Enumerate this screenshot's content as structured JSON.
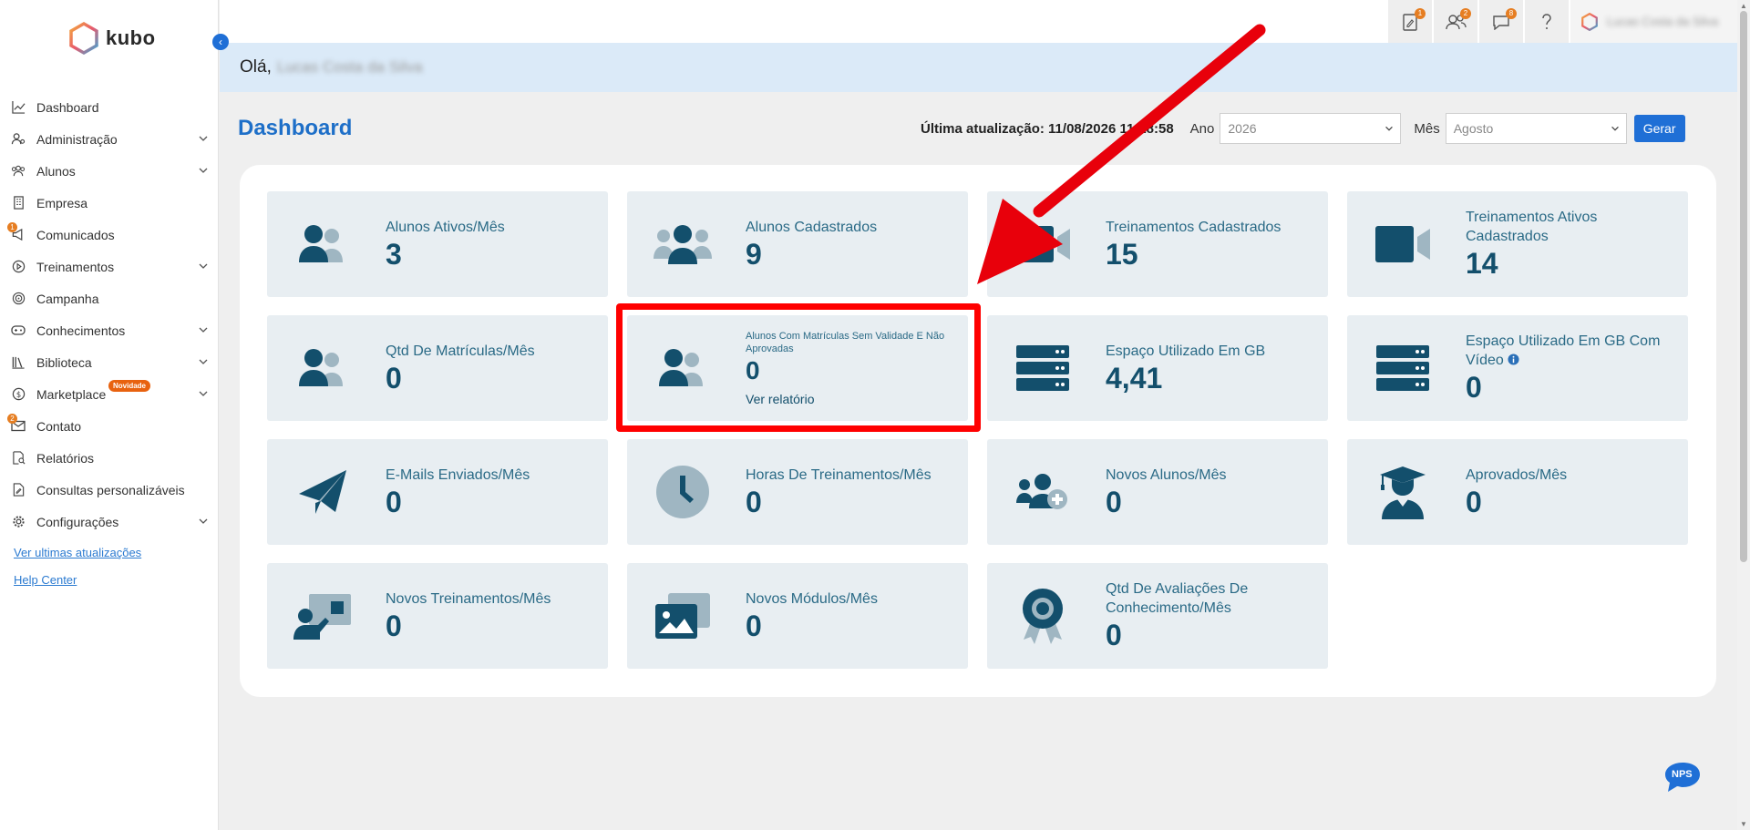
{
  "app": {
    "logo_text": "kubo"
  },
  "sidebar": {
    "items": [
      {
        "label": "Dashboard",
        "icon": "chart-line-icon",
        "chevron": false
      },
      {
        "label": "Administração",
        "icon": "users-gear-icon",
        "chevron": true
      },
      {
        "label": "Alunos",
        "icon": "students-icon",
        "chevron": true
      },
      {
        "label": "Empresa",
        "icon": "building-icon",
        "chevron": false
      },
      {
        "label": "Comunicados",
        "icon": "megaphone-icon",
        "chevron": false,
        "badge": "1"
      },
      {
        "label": "Treinamentos",
        "icon": "play-circle-icon",
        "chevron": true
      },
      {
        "label": "Campanha",
        "icon": "target-icon",
        "chevron": false
      },
      {
        "label": "Conhecimentos",
        "icon": "gamepad-icon",
        "chevron": true
      },
      {
        "label": "Biblioteca",
        "icon": "library-icon",
        "chevron": true
      },
      {
        "label": "Marketplace",
        "icon": "dollar-circle-icon",
        "chevron": true,
        "pill": "Novidade"
      },
      {
        "label": "Contato",
        "icon": "envelope-icon",
        "chevron": false,
        "badge": "2"
      },
      {
        "label": "Relatórios",
        "icon": "report-search-icon",
        "chevron": false
      },
      {
        "label": "Consultas personalizáveis",
        "icon": "document-edit-icon",
        "chevron": false
      },
      {
        "label": "Configurações",
        "icon": "gear-icon",
        "chevron": true
      }
    ],
    "links": {
      "updates": "Ver ultimas atualizações",
      "help": "Help Center"
    }
  },
  "topbar": {
    "badges": {
      "tasks": "1",
      "users": "2",
      "chat": "8"
    },
    "user_name": "Lucas Costa da Silva"
  },
  "greeting": {
    "prefix": "Olá,",
    "name": "Lucas Costa da Silva"
  },
  "header": {
    "title": "Dashboard",
    "last_update": "Última atualização: 11/08/2026 11:18:58",
    "year_label": "Ano",
    "year_value": "2026",
    "month_label": "Mês",
    "month_value": "Agosto",
    "generate_label": "Gerar"
  },
  "cards": [
    {
      "label": "Alunos Ativos/Mês",
      "value": "3",
      "icon": "users-icon"
    },
    {
      "label": "Alunos Cadastrados",
      "value": "9",
      "icon": "users-group-icon"
    },
    {
      "label": "Treinamentos Cadastrados",
      "value": "15",
      "icon": "video-camera-icon"
    },
    {
      "label": "Treinamentos Ativos Cadastrados",
      "value": "14",
      "icon": "video-camera-icon"
    },
    {
      "label": "Qtd De Matrículas/Mês",
      "value": "0",
      "icon": "users-icon"
    },
    {
      "label": "Alunos Com Matrículas Sem Validade E Não Aprovadas",
      "value": "0",
      "icon": "users-icon",
      "link": "Ver relatório"
    },
    {
      "label": "Espaço Utilizado Em GB",
      "value": "4,41",
      "icon": "server-icon"
    },
    {
      "label": "Espaço Utilizado Em GB Com Vídeo",
      "value": "0",
      "icon": "server-icon",
      "info": true
    },
    {
      "label": "E-Mails Enviados/Mês",
      "value": "0",
      "icon": "paper-plane-icon"
    },
    {
      "label": "Horas De Treinamentos/Mês",
      "value": "0",
      "icon": "clock-icon"
    },
    {
      "label": "Novos Alunos/Mês",
      "value": "0",
      "icon": "user-plus-icon"
    },
    {
      "label": "Aprovados/Mês",
      "value": "0",
      "icon": "graduate-icon"
    },
    {
      "label": "Novos Treinamentos/Mês",
      "value": "0",
      "icon": "teacher-board-icon"
    },
    {
      "label": "Novos Módulos/Mês",
      "value": "0",
      "icon": "images-icon"
    },
    {
      "label": "Qtd De Avaliações De Conhecimento/Mês",
      "value": "0",
      "icon": "award-icon"
    }
  ],
  "nps": {
    "label": "NPS"
  },
  "colors": {
    "accent": "#1f6fd6",
    "card_bg": "#e8eef2",
    "card_text": "#134f6c",
    "highlight": "#ff0000",
    "badge": "#e67e22"
  }
}
